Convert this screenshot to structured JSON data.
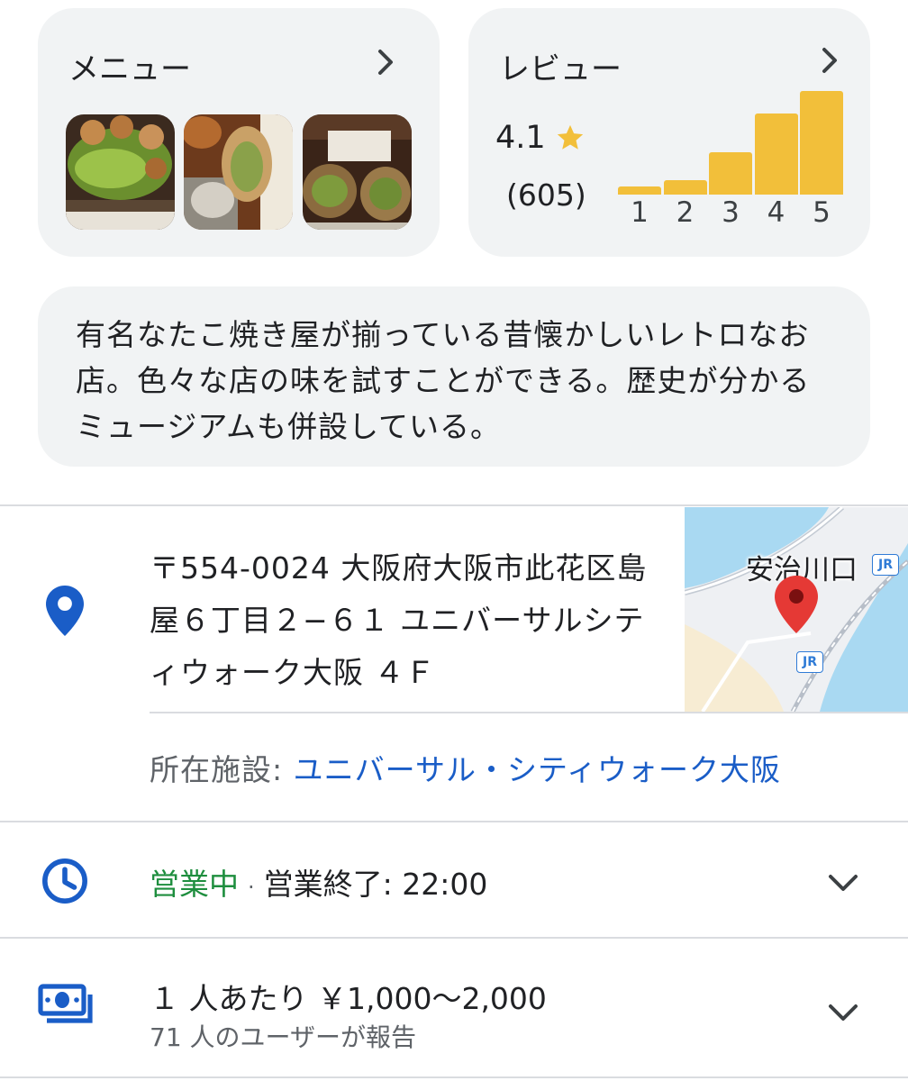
{
  "menu_card": {
    "title": "メニュー",
    "photos": [
      "menu-photo-1",
      "menu-photo-2",
      "menu-photo-3"
    ]
  },
  "review_card": {
    "title": "レビュー",
    "rating": "4.1",
    "count": "(605)",
    "distribution": [
      {
        "stars": "1",
        "fraction": 0.08
      },
      {
        "stars": "2",
        "fraction": 0.14
      },
      {
        "stars": "3",
        "fraction": 0.41
      },
      {
        "stars": "4",
        "fraction": 0.78
      },
      {
        "stars": "5",
        "fraction": 1.0
      }
    ]
  },
  "description": "有名なたこ焼き屋が揃っている昔懐かしいレトロなお店。色々な店の味を試すことができる。歴史が分かるミュージアムも併設している。",
  "address": {
    "text": "〒554-0024 大阪府大阪市此花区島屋６丁目２−６１ ユニバーサルシティウォーク大阪 ４Ｆ",
    "map_station": "安治川口",
    "map_badge": "JR"
  },
  "facility": {
    "label": "所在施設:",
    "value": "ユニバーサル・シティウォーク大阪"
  },
  "hours": {
    "status": "営業中",
    "separator": "·",
    "close": "営業終了: 22:00"
  },
  "price": {
    "text": "１ 人あたり ￥1,000〜2,000",
    "reports": "71 人のユーザーが報告"
  },
  "colors": {
    "star": "#f2bf3a",
    "link": "#1a5dc7",
    "open": "#1e8e3e",
    "icon": "#1a5dc7",
    "card": "#f1f3f4"
  }
}
